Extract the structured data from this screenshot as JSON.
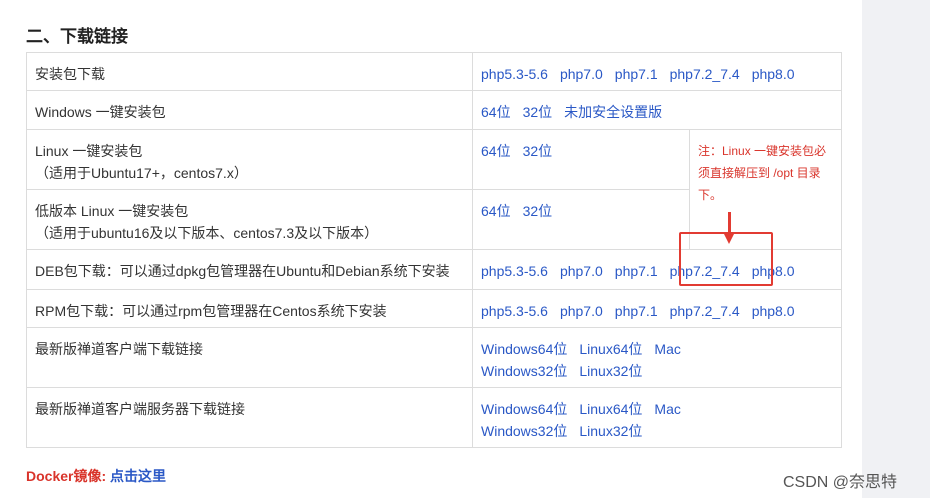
{
  "heading": "二、下载链接",
  "rows": [
    {
      "label": "安装包下载",
      "links": [
        "php5.3-5.6",
        "php7.0",
        "php7.1",
        "php7.2_7.4",
        "php8.0"
      ]
    },
    {
      "label": "Windows 一键安装包",
      "links": [
        "64位",
        "32位",
        "未加安全设置版"
      ]
    },
    {
      "label_line1": "Linux 一键安装包",
      "label_line2": "（适用于Ubuntu17+，centos7.x）",
      "links": [
        "64位",
        "32位"
      ]
    },
    {
      "label_line1": "低版本 Linux 一键安装包",
      "label_line2": "（适用于ubuntu16及以下版本、centos7.3及以下版本）",
      "links": [
        "64位",
        "32位"
      ]
    },
    {
      "label": "DEB包下载：可以通过dpkg包管理器在Ubuntu和Debian系统下安装",
      "links": [
        "php5.3-5.6",
        "php7.0",
        "php7.1",
        "php7.2_7.4",
        "php8.0"
      ]
    },
    {
      "label": "RPM包下载：可以通过rpm包管理器在Centos系统下安装",
      "links": [
        "php5.3-5.6",
        "php7.0",
        "php7.1",
        "php7.2_7.4",
        "php8.0"
      ]
    },
    {
      "label": "最新版禅道客户端下载链接",
      "links_line1": [
        "Windows64位",
        "Linux64位",
        "Mac"
      ],
      "links_line2": [
        "Windows32位",
        "Linux32位"
      ]
    },
    {
      "label": "最新版禅道客户端服务器下载链接",
      "links_line1": [
        "Windows64位",
        "Linux64位",
        "Mac"
      ],
      "links_line2": [
        "Windows32位",
        "Linux32位"
      ]
    }
  ],
  "note": "注：Linux 一键安装包必须直接解压到 /opt 目录下。",
  "docker": {
    "label": "Docker镜像:",
    "link": "点击这里"
  },
  "watermark": "CSDN @奈思特",
  "colors": {
    "link": "#2a58c6",
    "annotation_red": "#e23b32",
    "note_red": "#d9342b"
  }
}
